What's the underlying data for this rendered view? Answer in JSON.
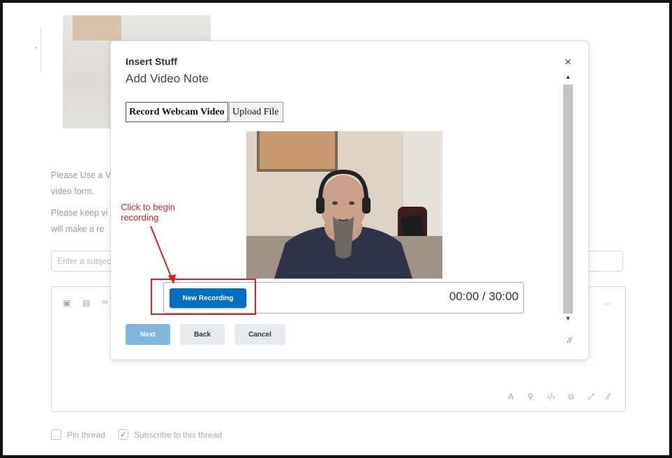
{
  "background": {
    "paragraph1_line1": "Please Use a V",
    "paragraph1_line2": "video form.",
    "paragraph2_line1": "Please keep vi",
    "paragraph2_line2": "will make a re",
    "subject_placeholder": "Enter a subject",
    "editor_more": "...",
    "pin_label": "Pin thread",
    "subscribe_label": "Subscribe to this thread"
  },
  "dialog": {
    "title": "Insert Stuff",
    "subtitle": "Add Video Note",
    "close_symbol": "×",
    "tabs": [
      {
        "label": "Record Webcam Video",
        "active": true
      },
      {
        "label": "Upload File",
        "active": false
      }
    ],
    "recorder": {
      "button_label": "New Recording",
      "timer": "00:00 / 30:00"
    },
    "buttons": {
      "next": "Next",
      "back": "Back",
      "cancel": "Cancel"
    }
  },
  "annotation": {
    "line1": "Click to begin",
    "line2": "recording",
    "color": "#e02020"
  },
  "colors": {
    "primary": "#006fbf",
    "primary_disabled": "#80b7df",
    "secondary": "#e7eaee"
  }
}
